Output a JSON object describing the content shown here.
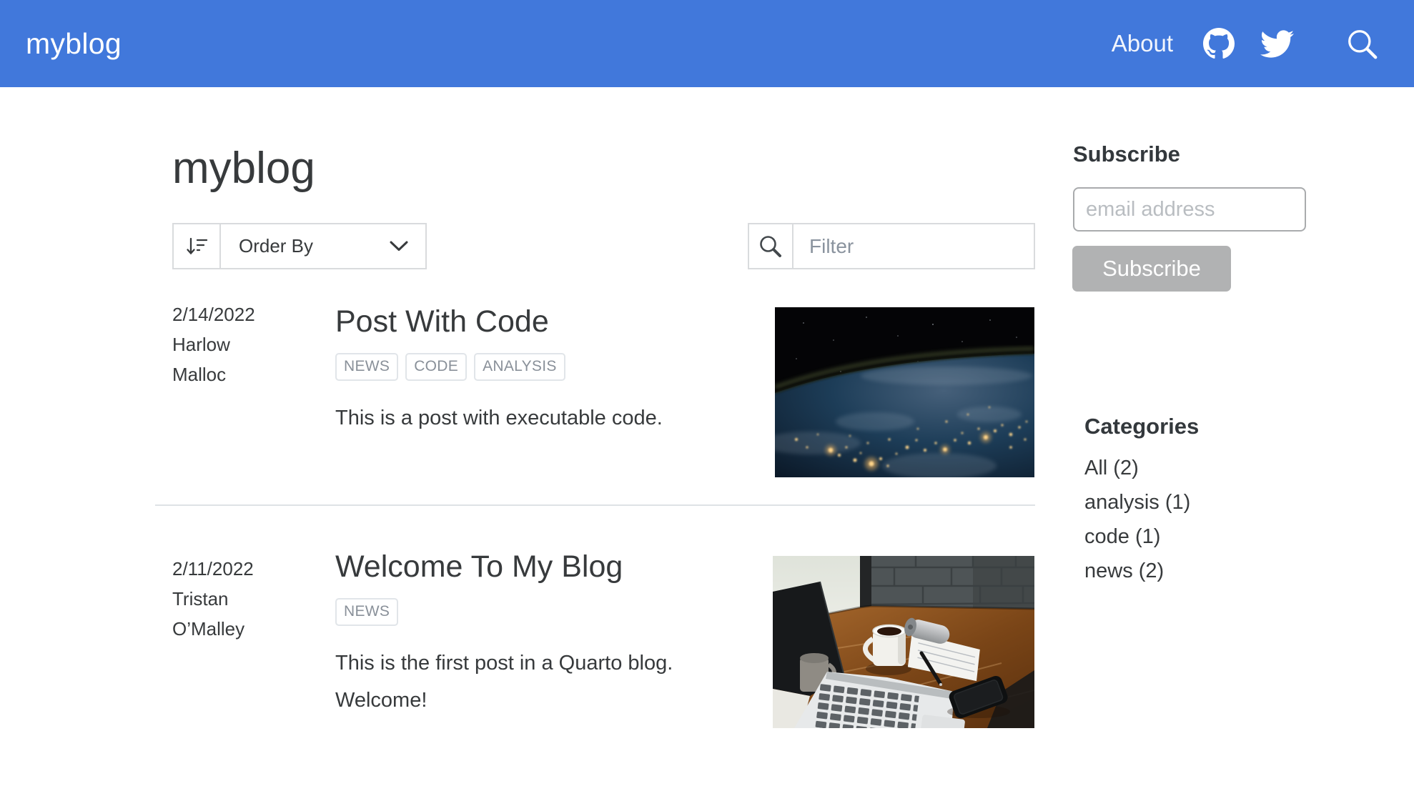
{
  "navbar": {
    "brand": "myblog",
    "about_label": "About",
    "bg_color": "#4178db"
  },
  "page": {
    "title": "myblog"
  },
  "toolbar": {
    "order_by_label": "Order By",
    "filter_placeholder": "Filter"
  },
  "posts": [
    {
      "date": "2/14/2022",
      "author": "Harlow Malloc",
      "title": "Post With Code",
      "tags": [
        "NEWS",
        "CODE",
        "ANALYSIS"
      ],
      "description": "This is a post with executable code.",
      "image_alt": "earth-from-space-at-night"
    },
    {
      "date": "2/11/2022",
      "author": "Tristan O’Malley",
      "title": "Welcome To My Blog",
      "tags": [
        "NEWS"
      ],
      "description": "This is the first post in a Quarto blog. Welcome!",
      "image_alt": "desk-with-laptop-and-coffee"
    }
  ],
  "sidebar": {
    "subscribe": {
      "heading": "Subscribe",
      "email_placeholder": "email address",
      "button_label": "Subscribe"
    },
    "categories": {
      "heading": "Categories",
      "items": [
        {
          "label": "All (2)"
        },
        {
          "label": "analysis (1)"
        },
        {
          "label": "code (1)"
        },
        {
          "label": "news (2)"
        }
      ]
    }
  }
}
